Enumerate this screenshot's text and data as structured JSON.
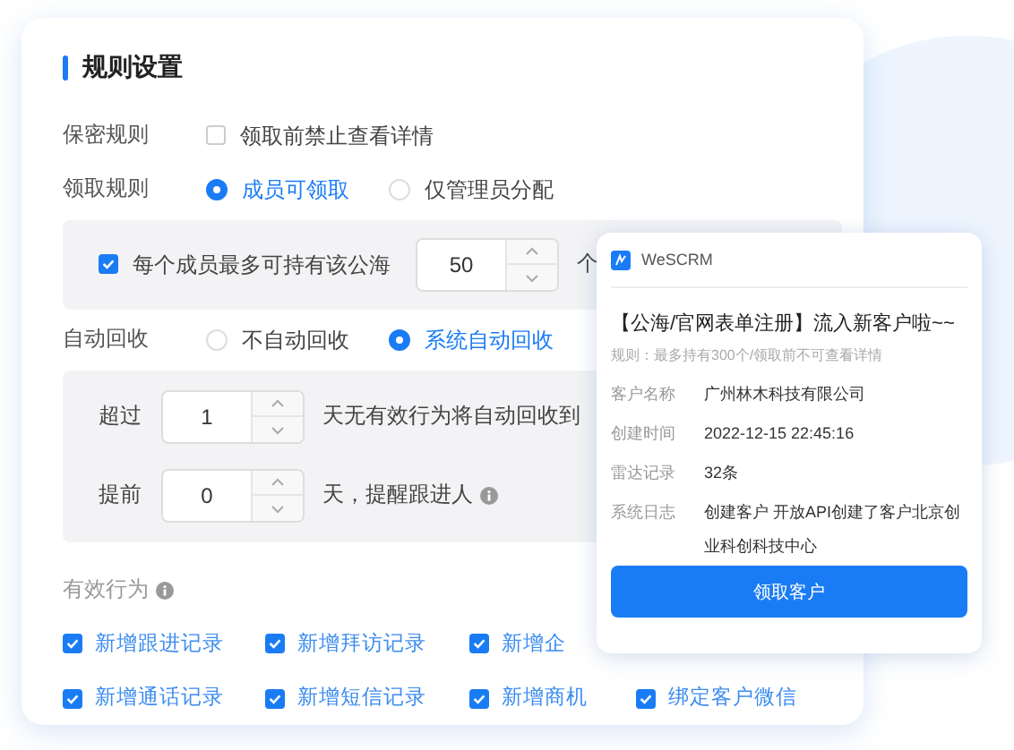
{
  "section": {
    "title": "规则设置"
  },
  "privacy": {
    "label": "保密规则",
    "option": {
      "label": "领取前禁止查看详情",
      "checked": false
    }
  },
  "claim": {
    "label": "领取规则",
    "options": [
      {
        "label": "成员可领取",
        "selected": true
      },
      {
        "label": "仅管理员分配",
        "selected": false
      }
    ]
  },
  "limit": {
    "checked": true,
    "label": "每个成员最多可持有该公海",
    "value": "50",
    "unit": "个"
  },
  "recycle": {
    "label": "自动回收",
    "options": [
      {
        "label": "不自动回收",
        "selected": false
      },
      {
        "label": "系统自动回收",
        "selected": true
      }
    ]
  },
  "recycle_settings": [
    {
      "label": "超过",
      "value": "1",
      "suffix": "天无有效行为将自动回收到",
      "info": false
    },
    {
      "label": "提前",
      "value": "0",
      "suffix": "天，提醒跟进人",
      "info": true
    }
  ],
  "effective": {
    "label": "有效行为",
    "info": true,
    "rows": [
      [
        {
          "label": "新增跟进记录",
          "checked": true
        },
        {
          "label": "新增拜访记录",
          "checked": true
        },
        {
          "label": "新增企",
          "checked": true
        }
      ],
      [
        {
          "label": "新增通话记录",
          "checked": true
        },
        {
          "label": "新增短信记录",
          "checked": true
        },
        {
          "label": "新增商机",
          "checked": true
        },
        {
          "label": "绑定客户微信",
          "checked": true
        }
      ]
    ]
  },
  "notification": {
    "app": "WeSCRM",
    "title": "【公海/官网表单注册】流入新客户啦~~",
    "rule": "规则：最多持有300个/领取前不可查看详情",
    "fields": [
      {
        "label": "客户名称",
        "value": "广州林木科技有限公司"
      },
      {
        "label": "创建时间",
        "value": "2022-12-15 22:45:16"
      },
      {
        "label": "雷达记录",
        "value": "32条"
      },
      {
        "label": "系统日志",
        "value": "创建客户 开放API创建了客户北京创业科创科技中心"
      }
    ],
    "button": "领取客户"
  }
}
